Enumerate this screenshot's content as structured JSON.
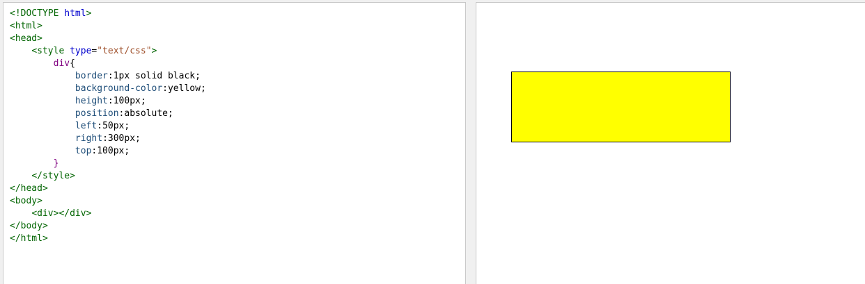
{
  "editor": {
    "lines": [
      {
        "parts": [
          {
            "cls": "tag",
            "text": "<!DOCTYPE "
          },
          {
            "cls": "kw",
            "text": "html"
          },
          {
            "cls": "tag",
            "text": ">"
          }
        ]
      },
      {
        "parts": [
          {
            "cls": "tag",
            "text": "<html>"
          }
        ]
      },
      {
        "parts": [
          {
            "cls": "tag",
            "text": "<head>"
          }
        ]
      },
      {
        "parts": [
          {
            "cls": "punct",
            "text": "    "
          },
          {
            "cls": "tag",
            "text": "<style "
          },
          {
            "cls": "kw",
            "text": "type"
          },
          {
            "cls": "punct",
            "text": "="
          },
          {
            "cls": "str",
            "text": "\"text/css\""
          },
          {
            "cls": "tag",
            "text": ">"
          }
        ]
      },
      {
        "parts": [
          {
            "cls": "punct",
            "text": "        "
          },
          {
            "cls": "sel",
            "text": "div"
          },
          {
            "cls": "punct",
            "text": "{"
          }
        ]
      },
      {
        "parts": [
          {
            "cls": "punct",
            "text": "            "
          },
          {
            "cls": "prop",
            "text": "border"
          },
          {
            "cls": "punct",
            "text": ":"
          },
          {
            "cls": "val",
            "text": "1px solid black;"
          }
        ]
      },
      {
        "parts": [
          {
            "cls": "punct",
            "text": "            "
          },
          {
            "cls": "prop",
            "text": "background-color"
          },
          {
            "cls": "punct",
            "text": ":"
          },
          {
            "cls": "val",
            "text": "yellow;"
          }
        ]
      },
      {
        "parts": [
          {
            "cls": "punct",
            "text": "            "
          },
          {
            "cls": "prop",
            "text": "height"
          },
          {
            "cls": "punct",
            "text": ":"
          },
          {
            "cls": "val",
            "text": "100px;"
          }
        ]
      },
      {
        "parts": [
          {
            "cls": "punct",
            "text": "            "
          },
          {
            "cls": "prop",
            "text": "position"
          },
          {
            "cls": "punct",
            "text": ":"
          },
          {
            "cls": "val",
            "text": "absolute;"
          }
        ]
      },
      {
        "parts": [
          {
            "cls": "punct",
            "text": "            "
          },
          {
            "cls": "prop",
            "text": "left"
          },
          {
            "cls": "punct",
            "text": ":"
          },
          {
            "cls": "val",
            "text": "50px;"
          }
        ]
      },
      {
        "parts": [
          {
            "cls": "punct",
            "text": "            "
          },
          {
            "cls": "prop",
            "text": "right"
          },
          {
            "cls": "punct",
            "text": ":"
          },
          {
            "cls": "val",
            "text": "300px;"
          }
        ]
      },
      {
        "parts": [
          {
            "cls": "punct",
            "text": "            "
          },
          {
            "cls": "prop",
            "text": "top"
          },
          {
            "cls": "punct",
            "text": ":"
          },
          {
            "cls": "val",
            "text": "100px;"
          }
        ]
      },
      {
        "parts": [
          {
            "cls": "punct",
            "text": "        "
          },
          {
            "cls": "sel",
            "text": "}"
          }
        ]
      },
      {
        "parts": [
          {
            "cls": "punct",
            "text": "    "
          },
          {
            "cls": "tag",
            "text": "</style>"
          }
        ]
      },
      {
        "parts": [
          {
            "cls": "tag",
            "text": "</head>"
          }
        ]
      },
      {
        "parts": [
          {
            "cls": "tag",
            "text": "<body>"
          }
        ]
      },
      {
        "parts": [
          {
            "cls": "punct",
            "text": "    "
          },
          {
            "cls": "tag",
            "text": "<div></div>"
          }
        ]
      },
      {
        "parts": [
          {
            "cls": "tag",
            "text": "</body>"
          }
        ]
      },
      {
        "parts": [
          {
            "cls": "tag",
            "text": "</html>"
          }
        ]
      }
    ]
  },
  "preview": {
    "box_color": "#ffff00",
    "border_color": "#000000"
  }
}
